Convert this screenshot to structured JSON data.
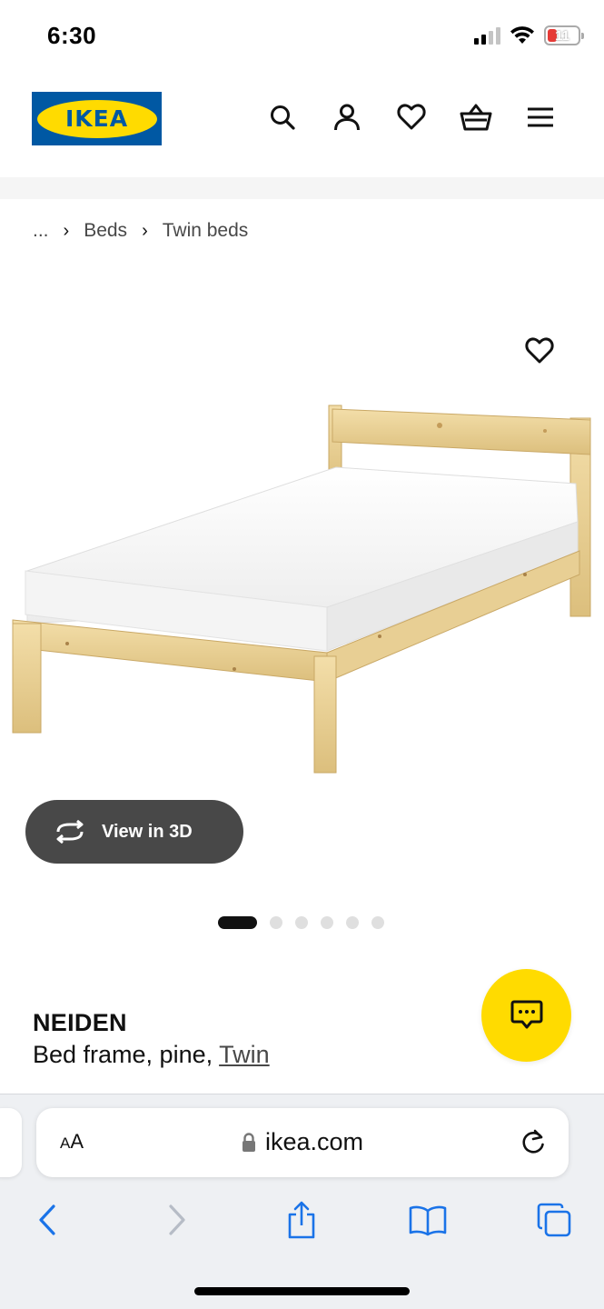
{
  "status_bar": {
    "time": "6:30",
    "battery": "11"
  },
  "header": {
    "logo_text": "IKEA",
    "icons": [
      "search-icon",
      "account-icon",
      "heart-icon",
      "cart-icon",
      "menu-icon"
    ]
  },
  "breadcrumb": {
    "ellipsis": "...",
    "items": [
      "Beds",
      "Twin beds"
    ]
  },
  "product": {
    "view_3d_label": "View in 3D",
    "carousel": {
      "total": 6,
      "active": 1
    },
    "name": "NEIDEN",
    "description_prefix": "Bed frame, pine, ",
    "size_link": "Twin"
  },
  "browser": {
    "aa_label_small": "A",
    "aa_label_large": "A",
    "url": "ikea.com"
  },
  "colors": {
    "ikea_blue": "#0058a3",
    "ikea_yellow": "#ffdb00",
    "view3d_bg": "#484848",
    "safari_accent": "#1a73e8"
  }
}
